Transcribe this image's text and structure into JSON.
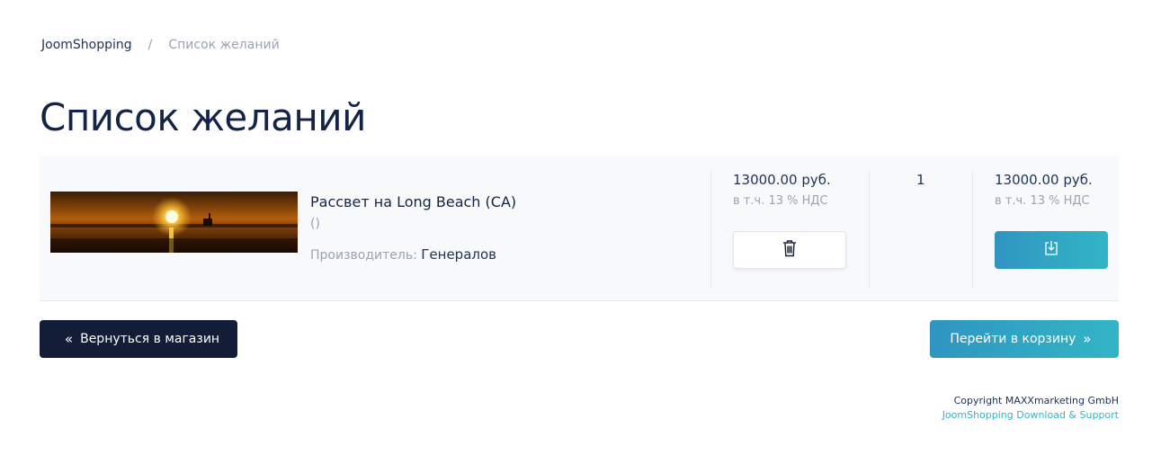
{
  "breadcrumb": {
    "home": "JoomShopping",
    "separator": "/",
    "current": "Список желаний"
  },
  "page_title": "Список желаний",
  "wishlist": {
    "items": [
      {
        "image_alt": "Рассвет на Long Beach (CA)",
        "name": "Рассвет на Long Beach (CA)",
        "attributes": "()",
        "manufacturer_label": "Производитель:",
        "manufacturer": "Генералов",
        "price": "13000.00 руб.",
        "price_tax": "в т.ч. 13 % НДС",
        "quantity": "1",
        "total": "13000.00 руб.",
        "total_tax": "в т.ч. 13 % НДС",
        "delete_icon": "trash-icon",
        "to_cart_icon": "download-to-cart-icon"
      }
    ]
  },
  "actions": {
    "back_label": "Вернуться в магазин",
    "back_icon": "double-chevron-left-icon",
    "go_cart_label": "Перейти в корзину",
    "go_cart_icon": "double-chevron-right-icon"
  },
  "footer": {
    "copyright": "Copyright MAXXmarketing GmbH",
    "support": "JoomShopping Download & Support"
  },
  "colors": {
    "dark_button": "#131d38",
    "accent_start": "#2f95c1",
    "accent_end": "#33b5c6",
    "row_bg": "#f7f9fb"
  }
}
